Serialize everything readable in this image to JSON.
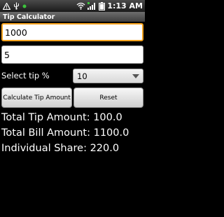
{
  "status_bar": {
    "icons": [
      "warning-icon",
      "usb-icon",
      "notification-dot-icon",
      "wifi-icon",
      "signal-icon",
      "battery-icon"
    ],
    "clock": "1:13 AM"
  },
  "app": {
    "title": "Tip Calculator"
  },
  "form": {
    "bill_amount_value": "1000",
    "people_value": "5",
    "select_tip_label": "Select tip %",
    "tip_selected": "10",
    "calculate_label": "Calculate Tip Amount",
    "reset_label": "Reset"
  },
  "results": {
    "total_tip": "Total Tip Amount: 100.0",
    "total_bill": "Total Bill Amount: 1100.0",
    "individual_share": "Individual Share: 220.0"
  },
  "colors": {
    "focus_border": "#f6a21c",
    "background": "#000000",
    "notification_dot": "#3cc43c"
  }
}
